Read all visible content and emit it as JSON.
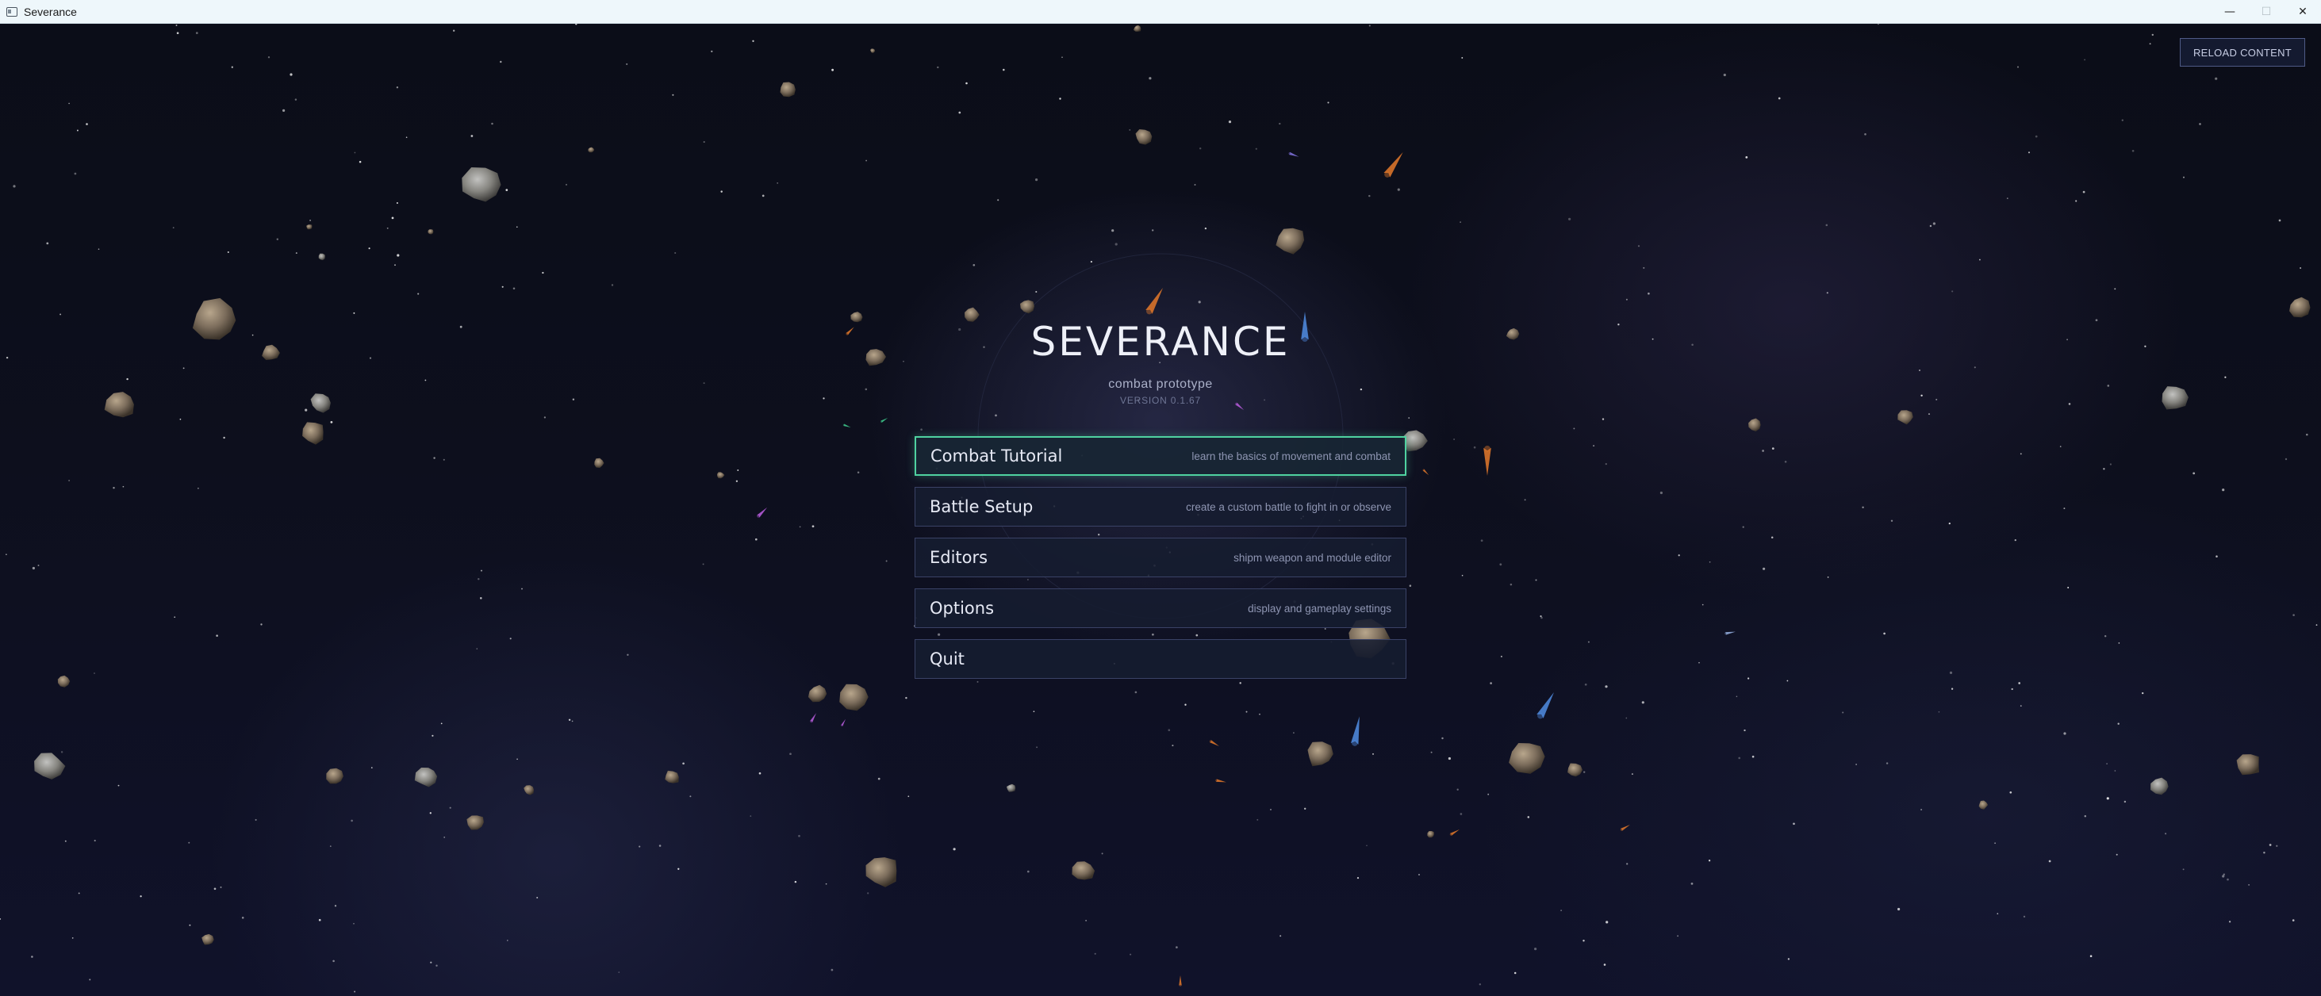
{
  "window": {
    "title": "Severance",
    "minimize_glyph": "—",
    "maximize_glyph": "☐",
    "close_glyph": "✕"
  },
  "toolbar": {
    "reload_label": "RELOAD CONTENT"
  },
  "main": {
    "title": "SEVERANCE",
    "subtitle": "combat prototype",
    "version": "VERSION 0.1.67"
  },
  "menu": [
    {
      "label": "Combat Tutorial",
      "description": "learn the basics of movement and combat",
      "active": true
    },
    {
      "label": "Battle Setup",
      "description": "create a custom battle to fight in or observe",
      "active": false
    },
    {
      "label": "Editors",
      "description": "shipm weapon and module editor",
      "active": false
    },
    {
      "label": "Options",
      "description": "display and gameplay settings",
      "active": false
    },
    {
      "label": "Quit",
      "description": "",
      "active": false
    }
  ],
  "colors": {
    "active_border": "#4fd2a0",
    "menu_border": "#3a4266",
    "background": "#0a0c14",
    "asteroid": "#7c6d5c",
    "ship_orange": "#d8732a",
    "ship_blue": "#4c86d8"
  }
}
